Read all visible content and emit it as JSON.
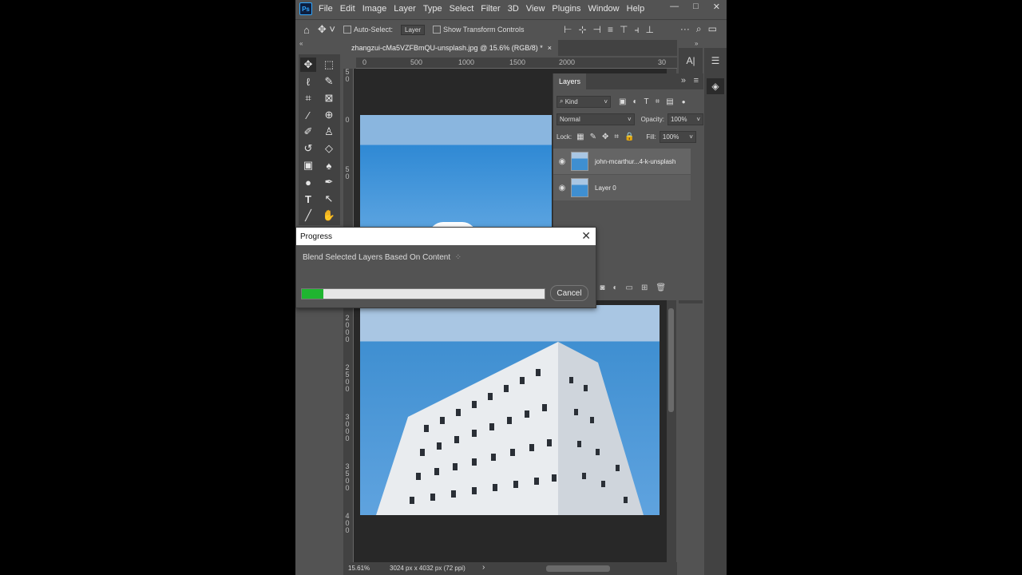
{
  "app": {
    "logo": "Ps"
  },
  "menu": [
    "File",
    "Edit",
    "Image",
    "Layer",
    "Type",
    "Select",
    "Filter",
    "3D",
    "View",
    "Plugins",
    "Window",
    "Help"
  ],
  "window_controls": {
    "minimize": "—",
    "restore": "□",
    "close": "✕"
  },
  "options_bar": {
    "auto_select_label": "Auto-Select:",
    "auto_select_value": "Layer",
    "transform_label": "Show Transform Controls"
  },
  "document": {
    "tab_title": "zhangzui-cMa5VZFBmQU-unsplash.jpg @ 15.6% (RGB/8) *",
    "tab_close": "×"
  },
  "ruler": {
    "top": [
      "0",
      "500",
      "1000",
      "1500",
      "2000",
      "30"
    ],
    "left": [
      "5\n0",
      "0",
      "5\n0",
      "2\n0\n0\n0",
      "2\n5\n0\n0",
      "3\n0\n0\n0",
      "3\n5\n0\n0",
      "4\n0\n0"
    ]
  },
  "status": {
    "zoom": "15.61%",
    "info": "3024 px x 4032 px (72 ppi)"
  },
  "layers_panel": {
    "tab": "Layers",
    "filter_kind": "Kind",
    "blend_mode": "Normal",
    "opacity_label": "Opacity:",
    "opacity_value": "100%",
    "lock_label": "Lock:",
    "fill_label": "Fill:",
    "fill_value": "100%",
    "layers": [
      {
        "name": "john-mcarthur...4-k-unsplash",
        "selected": true
      },
      {
        "name": "Layer 0",
        "selected": false
      }
    ]
  },
  "progress_dialog": {
    "title": "Progress",
    "message": "Blend Selected Layers Based On Content",
    "progress": 0.09,
    "cancel_label": "Cancel",
    "close": "✕"
  },
  "colors": {
    "progress_fill": "#1fb530",
    "panel_bg": "#535353",
    "dark_bg": "#424242"
  }
}
